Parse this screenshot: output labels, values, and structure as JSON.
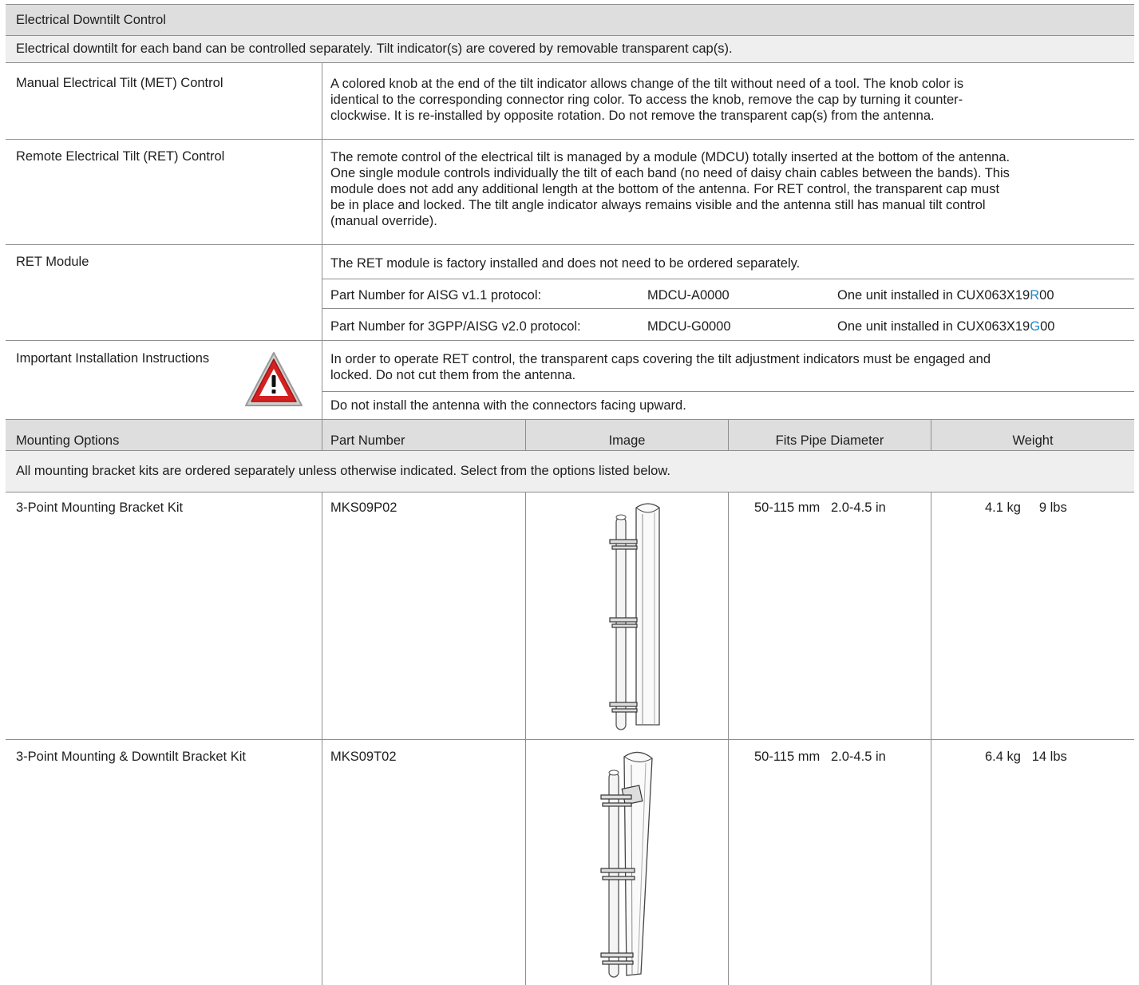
{
  "electrical": {
    "header": "Electrical Downtilt Control",
    "intro": "Electrical downtilt for each band can be controlled separately.  Tilt indicator(s) are covered by removable transparent cap(s).",
    "met": {
      "label": "Manual Electrical Tilt (MET) Control",
      "lines": [
        "A colored knob at the end of the tilt indicator allows change of the tilt without need of a tool.  The knob color is",
        "identical to the corresponding connector ring color.  To access the knob, remove the cap by turning it counter-",
        "clockwise.  It is re-installed by opposite rotation.  Do not remove the transparent cap(s) from the antenna."
      ]
    },
    "ret": {
      "label": "Remote Electrical Tilt (RET) Control",
      "lines": [
        "The remote control of the electrical tilt is managed by a module (MDCU) totally inserted at the bottom of the antenna.",
        "One single module controls individually the tilt of each band (no need of daisy chain cables between the bands).  This",
        "module does not add any additional length at the bottom of the antenna.  For RET control, the transparent cap must",
        "be in place and locked.  The tilt angle indicator always remains visible and the antenna still has manual tilt control",
        "(manual override)."
      ]
    },
    "ret_module": {
      "label": "RET Module",
      "note": "The RET module is factory installed and does not need to be ordered separately.",
      "rows": [
        {
          "protocol": "Part Number for AISG v1.1 protocol:",
          "part": "MDCU-A0000",
          "install_prefix": "One unit installed in CUX063X19",
          "letter": "R",
          "install_suffix": "00"
        },
        {
          "protocol": "Part Number for 3GPP/AISG v2.0 protocol:",
          "part": "MDCU-G0000",
          "install_prefix": "One unit installed in CUX063X19",
          "letter": "G",
          "install_suffix": "00"
        }
      ]
    },
    "installation": {
      "label": "Important Installation Instructions",
      "lines": [
        "In order to operate RET control, the transparent caps covering the tilt adjustment indicators must be engaged and",
        "locked.  Do not cut them from the antenna."
      ],
      "note2": "Do not install the antenna with the connectors facing upward."
    }
  },
  "mounting": {
    "columns": [
      "Mounting Options",
      "Part Number",
      "Image",
      "Fits Pipe Diameter",
      "Weight"
    ],
    "intro": "All mounting bracket kits are ordered separately unless otherwise indicated.  Select from the options listed below.",
    "rows": [
      {
        "name": "3-Point Mounting Bracket Kit",
        "part": "MKS09P02",
        "diameter_mm": "50-115 mm",
        "diameter_in": "2.0-4.5 in",
        "weight_kg": "4.1 kg",
        "weight_lbs": "9 lbs"
      },
      {
        "name": "3-Point Mounting & Downtilt Bracket Kit",
        "part": "MKS09T02",
        "diameter_mm": "50-115 mm",
        "diameter_in": "2.0-4.5 in",
        "weight_kg": "6.4 kg",
        "weight_lbs": "14 lbs"
      }
    ]
  },
  "colors": {
    "header_bg": "#dedede",
    "subheader_bg": "#efefef",
    "rule": "#8e8e8e",
    "accent": "#1e88c7",
    "warning_red": "#d42020"
  },
  "icons": {
    "warning": "warning-triangle-icon"
  }
}
